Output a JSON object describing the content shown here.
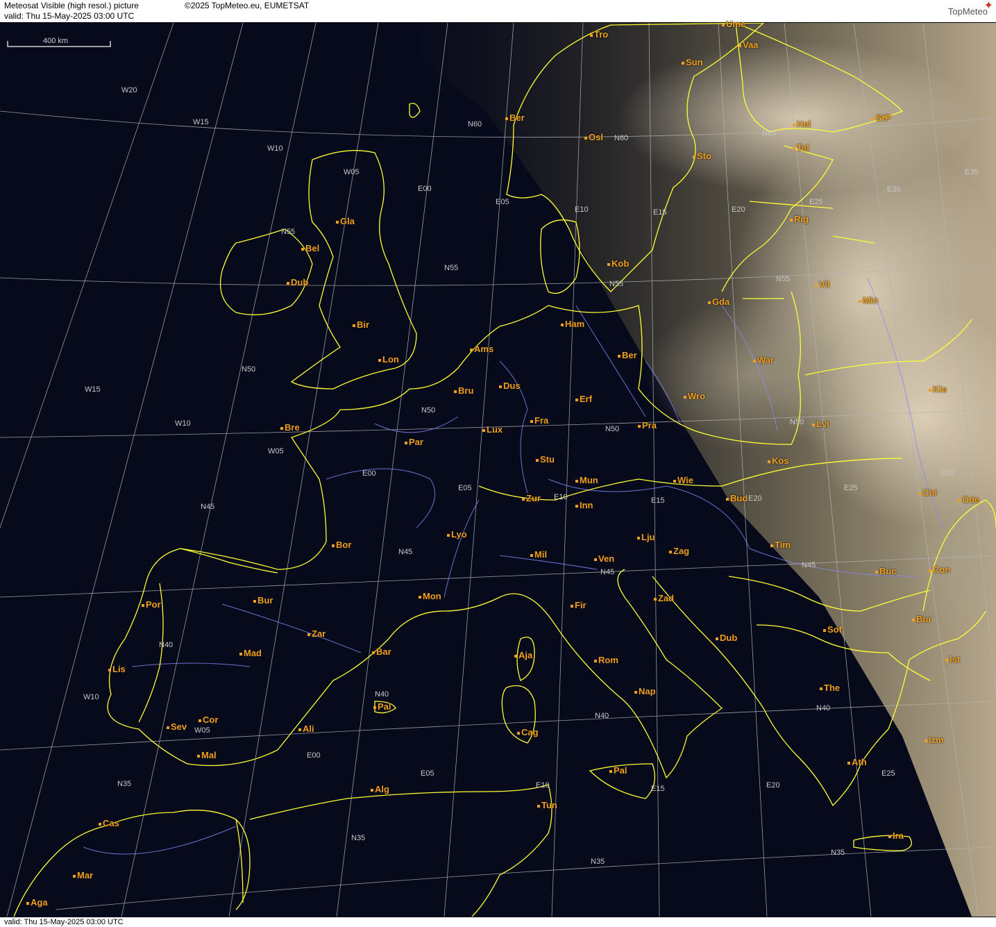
{
  "header": {
    "line1": "Meteosat Visible (high resol.) picture",
    "line2": "valid:  Thu  15-May-2025  03:00 UTC",
    "copyright": "©2025 TopMeteo.eu, EUMETSAT",
    "logo": "TopMeteo"
  },
  "footer": {
    "valid": "valid:  Thu  15-May-2025  03:00 UTC"
  },
  "scale": {
    "label": "400 km"
  },
  "colors": {
    "coast": "#ffff33",
    "city": "#f0a020",
    "graticule": "#b4b4b4",
    "river": "#8888ff",
    "sea": "#070a1b"
  },
  "cities": [
    {
      "label": "Tro"
    },
    {
      "label": "Ume"
    },
    {
      "label": "Vaa"
    },
    {
      "label": "Sun"
    },
    {
      "label": "Ber"
    },
    {
      "label": "Hel"
    },
    {
      "label": "StP"
    },
    {
      "label": "Osl"
    },
    {
      "label": "Sto"
    },
    {
      "label": "Tal"
    },
    {
      "label": "Gla"
    },
    {
      "label": "Rig"
    },
    {
      "label": "Bel"
    },
    {
      "label": "Kob"
    },
    {
      "label": "Dub"
    },
    {
      "label": "Vil"
    },
    {
      "label": "Gda"
    },
    {
      "label": "Min"
    },
    {
      "label": "Ham"
    },
    {
      "label": "Bir"
    },
    {
      "label": "Ams"
    },
    {
      "label": "Ber"
    },
    {
      "label": "Lon"
    },
    {
      "label": "War"
    },
    {
      "label": "Dus"
    },
    {
      "label": "Bru"
    },
    {
      "label": "Erf"
    },
    {
      "label": "Wro"
    },
    {
      "label": "Kie"
    },
    {
      "label": "Fra"
    },
    {
      "label": "Lux"
    },
    {
      "label": "Pra"
    },
    {
      "label": "Lvi"
    },
    {
      "label": "Bre"
    },
    {
      "label": "Par"
    },
    {
      "label": "Stu"
    },
    {
      "label": "Kos"
    },
    {
      "label": "Mun"
    },
    {
      "label": "Wie"
    },
    {
      "label": "Chi"
    },
    {
      "label": "Ode"
    },
    {
      "label": "Bud"
    },
    {
      "label": "Zur"
    },
    {
      "label": "Inn"
    },
    {
      "label": "Lyo"
    },
    {
      "label": "Lju"
    },
    {
      "label": "Bor"
    },
    {
      "label": "Tim"
    },
    {
      "label": "Zag"
    },
    {
      "label": "Mil"
    },
    {
      "label": "Ven"
    },
    {
      "label": "Buc"
    },
    {
      "label": "Con"
    },
    {
      "label": "Mon"
    },
    {
      "label": "Bur"
    },
    {
      "label": "Zad"
    },
    {
      "label": "Fir"
    },
    {
      "label": "Por"
    },
    {
      "label": "Bur"
    },
    {
      "label": "Zar"
    },
    {
      "label": "Sof"
    },
    {
      "label": "Dub"
    },
    {
      "label": "Bar"
    },
    {
      "label": "Mad"
    },
    {
      "label": "Aja"
    },
    {
      "label": "Rom"
    },
    {
      "label": "Ist"
    },
    {
      "label": "Lis"
    },
    {
      "label": "The"
    },
    {
      "label": "Nap"
    },
    {
      "label": "Pal"
    },
    {
      "label": "Sev"
    },
    {
      "label": "Cor"
    },
    {
      "label": "Ali"
    },
    {
      "label": "Cag"
    },
    {
      "label": "Izm"
    },
    {
      "label": "Mal"
    },
    {
      "label": "Pal"
    },
    {
      "label": "Ath"
    },
    {
      "label": "Alg"
    },
    {
      "label": "Tun"
    },
    {
      "label": "Cas"
    },
    {
      "label": "Ira"
    },
    {
      "label": "Mar"
    },
    {
      "label": "Aga"
    }
  ],
  "gridlabels": [
    {
      "label": "W20"
    },
    {
      "label": "W15"
    },
    {
      "label": "W10"
    },
    {
      "label": "W05"
    },
    {
      "label": "E00"
    },
    {
      "label": "E05"
    },
    {
      "label": "E10"
    },
    {
      "label": "E15"
    },
    {
      "label": "E20"
    },
    {
      "label": "E25"
    },
    {
      "label": "E30"
    },
    {
      "label": "E35"
    },
    {
      "label": "N60"
    },
    {
      "label": "N60"
    },
    {
      "label": "N60"
    },
    {
      "label": "N55"
    },
    {
      "label": "N55"
    },
    {
      "label": "N55"
    },
    {
      "label": "N55"
    },
    {
      "label": "N50"
    },
    {
      "label": "N50"
    },
    {
      "label": "N50"
    },
    {
      "label": "N50"
    },
    {
      "label": "W15"
    },
    {
      "label": "W10"
    },
    {
      "label": "W05"
    },
    {
      "label": "E00"
    },
    {
      "label": "E05"
    },
    {
      "label": "E10"
    },
    {
      "label": "E15"
    },
    {
      "label": "E20"
    },
    {
      "label": "E25"
    },
    {
      "label": "E30"
    },
    {
      "label": "N45"
    },
    {
      "label": "N45"
    },
    {
      "label": "N45"
    },
    {
      "label": "N45"
    },
    {
      "label": "N40"
    },
    {
      "label": "N40"
    },
    {
      "label": "N40"
    },
    {
      "label": "N40"
    },
    {
      "label": "W10"
    },
    {
      "label": "W05"
    },
    {
      "label": "E00"
    },
    {
      "label": "E05"
    },
    {
      "label": "E10"
    },
    {
      "label": "E15"
    },
    {
      "label": "E20"
    },
    {
      "label": "E25"
    },
    {
      "label": "N35"
    },
    {
      "label": "N35"
    },
    {
      "label": "N35"
    },
    {
      "label": "N35"
    }
  ]
}
